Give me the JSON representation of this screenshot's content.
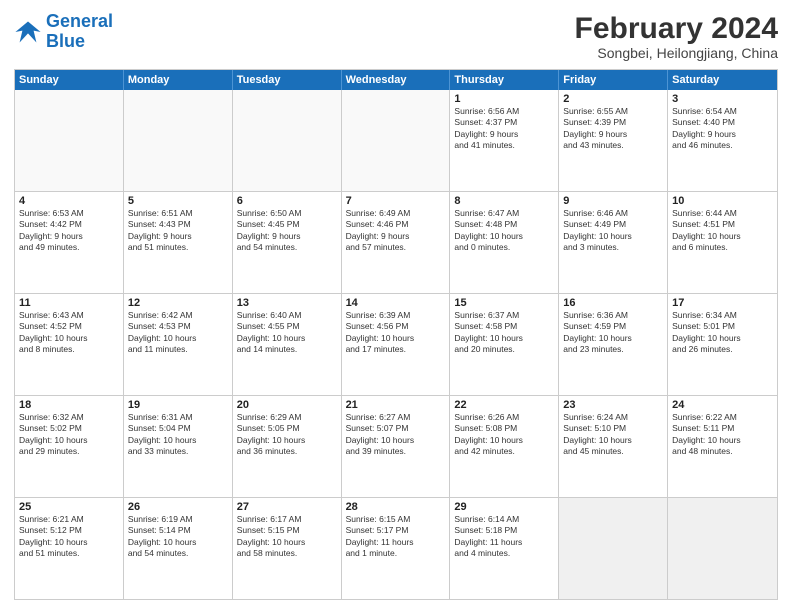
{
  "logo": {
    "line1": "General",
    "line2": "Blue"
  },
  "header": {
    "month": "February 2024",
    "location": "Songbei, Heilongjiang, China"
  },
  "weekdays": [
    "Sunday",
    "Monday",
    "Tuesday",
    "Wednesday",
    "Thursday",
    "Friday",
    "Saturday"
  ],
  "rows": [
    [
      {
        "day": "",
        "info": "",
        "empty": true
      },
      {
        "day": "",
        "info": "",
        "empty": true
      },
      {
        "day": "",
        "info": "",
        "empty": true
      },
      {
        "day": "",
        "info": "",
        "empty": true
      },
      {
        "day": "1",
        "info": "Sunrise: 6:56 AM\nSunset: 4:37 PM\nDaylight: 9 hours\nand 41 minutes."
      },
      {
        "day": "2",
        "info": "Sunrise: 6:55 AM\nSunset: 4:39 PM\nDaylight: 9 hours\nand 43 minutes."
      },
      {
        "day": "3",
        "info": "Sunrise: 6:54 AM\nSunset: 4:40 PM\nDaylight: 9 hours\nand 46 minutes."
      }
    ],
    [
      {
        "day": "4",
        "info": "Sunrise: 6:53 AM\nSunset: 4:42 PM\nDaylight: 9 hours\nand 49 minutes."
      },
      {
        "day": "5",
        "info": "Sunrise: 6:51 AM\nSunset: 4:43 PM\nDaylight: 9 hours\nand 51 minutes."
      },
      {
        "day": "6",
        "info": "Sunrise: 6:50 AM\nSunset: 4:45 PM\nDaylight: 9 hours\nand 54 minutes."
      },
      {
        "day": "7",
        "info": "Sunrise: 6:49 AM\nSunset: 4:46 PM\nDaylight: 9 hours\nand 57 minutes."
      },
      {
        "day": "8",
        "info": "Sunrise: 6:47 AM\nSunset: 4:48 PM\nDaylight: 10 hours\nand 0 minutes."
      },
      {
        "day": "9",
        "info": "Sunrise: 6:46 AM\nSunset: 4:49 PM\nDaylight: 10 hours\nand 3 minutes."
      },
      {
        "day": "10",
        "info": "Sunrise: 6:44 AM\nSunset: 4:51 PM\nDaylight: 10 hours\nand 6 minutes."
      }
    ],
    [
      {
        "day": "11",
        "info": "Sunrise: 6:43 AM\nSunset: 4:52 PM\nDaylight: 10 hours\nand 8 minutes."
      },
      {
        "day": "12",
        "info": "Sunrise: 6:42 AM\nSunset: 4:53 PM\nDaylight: 10 hours\nand 11 minutes."
      },
      {
        "day": "13",
        "info": "Sunrise: 6:40 AM\nSunset: 4:55 PM\nDaylight: 10 hours\nand 14 minutes."
      },
      {
        "day": "14",
        "info": "Sunrise: 6:39 AM\nSunset: 4:56 PM\nDaylight: 10 hours\nand 17 minutes."
      },
      {
        "day": "15",
        "info": "Sunrise: 6:37 AM\nSunset: 4:58 PM\nDaylight: 10 hours\nand 20 minutes."
      },
      {
        "day": "16",
        "info": "Sunrise: 6:36 AM\nSunset: 4:59 PM\nDaylight: 10 hours\nand 23 minutes."
      },
      {
        "day": "17",
        "info": "Sunrise: 6:34 AM\nSunset: 5:01 PM\nDaylight: 10 hours\nand 26 minutes."
      }
    ],
    [
      {
        "day": "18",
        "info": "Sunrise: 6:32 AM\nSunset: 5:02 PM\nDaylight: 10 hours\nand 29 minutes."
      },
      {
        "day": "19",
        "info": "Sunrise: 6:31 AM\nSunset: 5:04 PM\nDaylight: 10 hours\nand 33 minutes."
      },
      {
        "day": "20",
        "info": "Sunrise: 6:29 AM\nSunset: 5:05 PM\nDaylight: 10 hours\nand 36 minutes."
      },
      {
        "day": "21",
        "info": "Sunrise: 6:27 AM\nSunset: 5:07 PM\nDaylight: 10 hours\nand 39 minutes."
      },
      {
        "day": "22",
        "info": "Sunrise: 6:26 AM\nSunset: 5:08 PM\nDaylight: 10 hours\nand 42 minutes."
      },
      {
        "day": "23",
        "info": "Sunrise: 6:24 AM\nSunset: 5:10 PM\nDaylight: 10 hours\nand 45 minutes."
      },
      {
        "day": "24",
        "info": "Sunrise: 6:22 AM\nSunset: 5:11 PM\nDaylight: 10 hours\nand 48 minutes."
      }
    ],
    [
      {
        "day": "25",
        "info": "Sunrise: 6:21 AM\nSunset: 5:12 PM\nDaylight: 10 hours\nand 51 minutes."
      },
      {
        "day": "26",
        "info": "Sunrise: 6:19 AM\nSunset: 5:14 PM\nDaylight: 10 hours\nand 54 minutes."
      },
      {
        "day": "27",
        "info": "Sunrise: 6:17 AM\nSunset: 5:15 PM\nDaylight: 10 hours\nand 58 minutes."
      },
      {
        "day": "28",
        "info": "Sunrise: 6:15 AM\nSunset: 5:17 PM\nDaylight: 11 hours\nand 1 minute."
      },
      {
        "day": "29",
        "info": "Sunrise: 6:14 AM\nSunset: 5:18 PM\nDaylight: 11 hours\nand 4 minutes."
      },
      {
        "day": "",
        "info": "",
        "empty": true,
        "shaded": true
      },
      {
        "day": "",
        "info": "",
        "empty": true,
        "shaded": true
      }
    ]
  ]
}
